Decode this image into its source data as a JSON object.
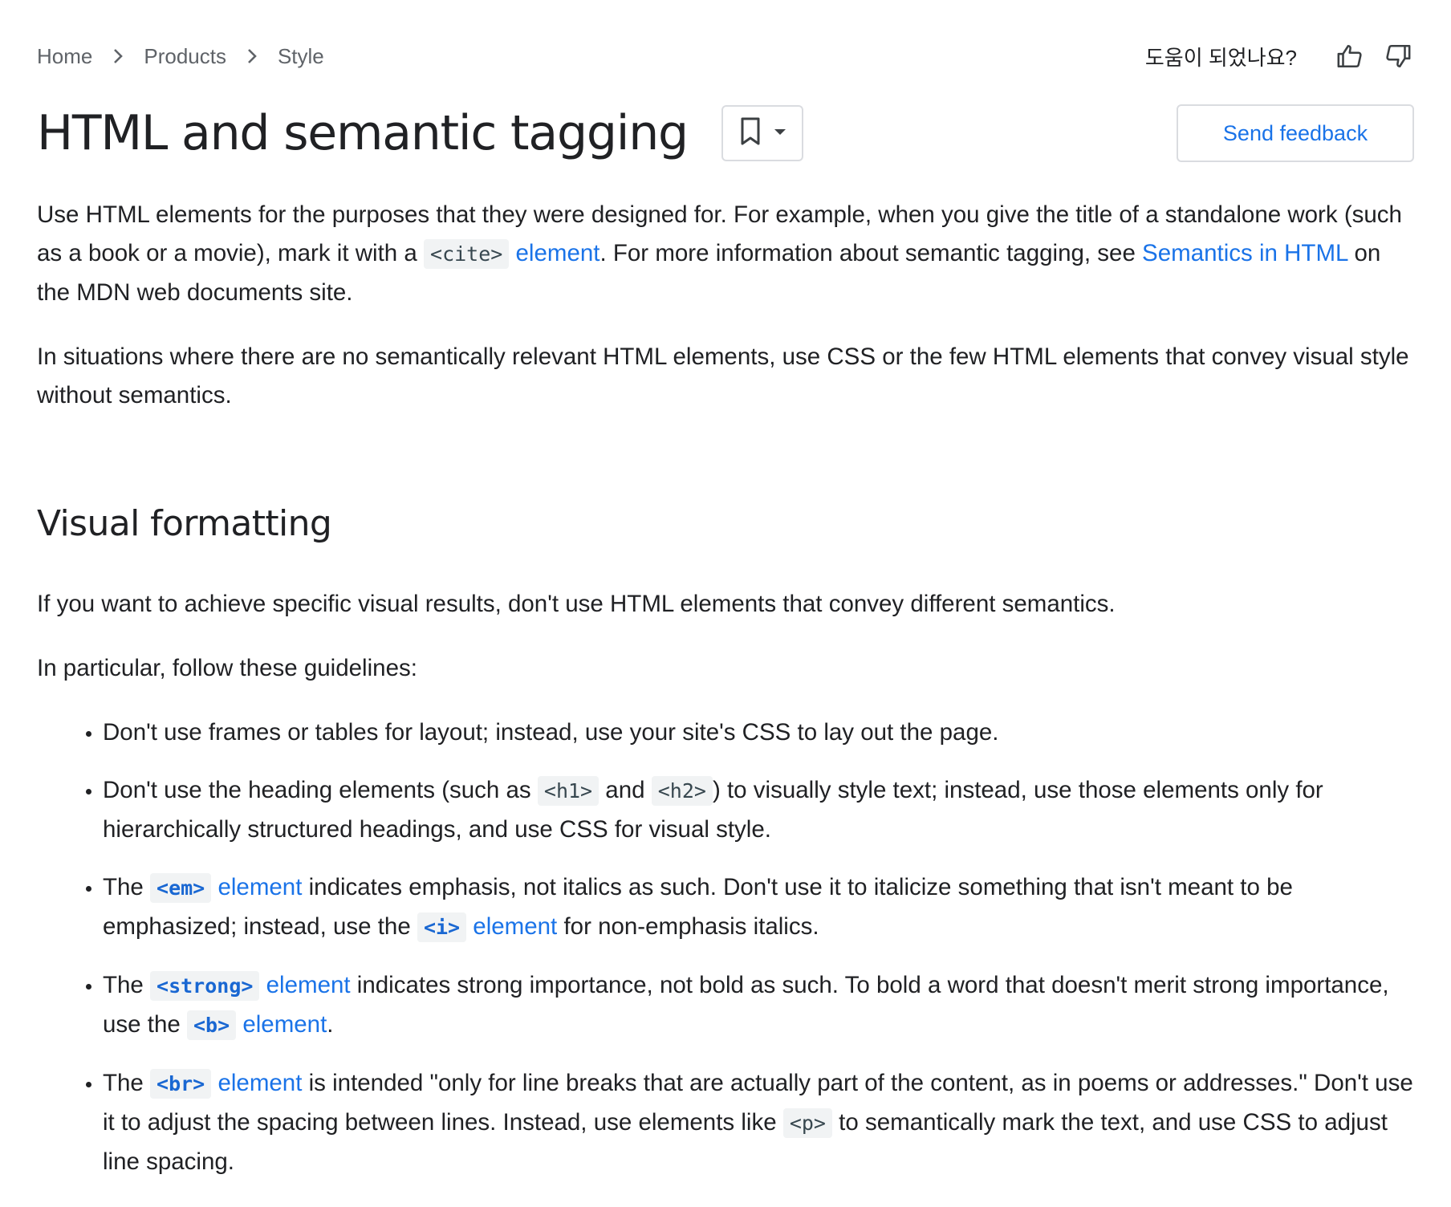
{
  "breadcrumb": {
    "items": [
      "Home",
      "Products",
      "Style"
    ]
  },
  "helpful": {
    "question": "도움이 되었나요?",
    "up_icon": "thumb-up-icon",
    "down_icon": "thumb-down-icon"
  },
  "page": {
    "title": "HTML and semantic tagging",
    "bookmark_icon": "bookmark-icon",
    "dropdown_icon": "caret-down-icon",
    "feedback_label": "Send feedback"
  },
  "intro": {
    "p1_a": "Use HTML elements for the purposes that they were designed for. For example, when you give the title of a standalone work (such as a book or a movie), mark it with a ",
    "p1_code": "<cite>",
    "p1_link": " element",
    "p1_b": ". For more information about semantic tagging, see ",
    "p1_link2": "Semantics in HTML",
    "p1_c": " on the MDN web documents site.",
    "p2": "In situations where there are no semantically relevant HTML elements, use CSS or the few HTML elements that convey visual style without semantics."
  },
  "section": {
    "heading": "Visual formatting",
    "p1": "If you want to achieve specific visual results, don't use HTML elements that convey different semantics.",
    "p2": "In particular, follow these guidelines:",
    "li1": "Don't use frames or tables for layout; instead, use your site's CSS to lay out the page.",
    "li2_a": "Don't use the heading elements (such as ",
    "li2_code1": "<h1>",
    "li2_b": " and ",
    "li2_code2": "<h2>",
    "li2_c": ") to visually style text; instead, use those elements only for hierarchically structured headings, and use CSS for visual style.",
    "li3_a": "The ",
    "li3_code1": "<em>",
    "li3_link1": " element",
    "li3_b": " indicates emphasis, not italics as such. Don't use it to italicize something that isn't meant to be emphasized; instead, use the ",
    "li3_code2": "<i>",
    "li3_link2": " element",
    "li3_c": " for non-emphasis italics.",
    "li4_a": "The ",
    "li4_code1": "<strong>",
    "li4_link1": " element",
    "li4_b": " indicates strong importance, not bold as such. To bold a word that doesn't merit strong importance, use the ",
    "li4_code2": "<b>",
    "li4_link2": " element",
    "li4_c": ".",
    "li5_a": "The ",
    "li5_code1": "<br>",
    "li5_link1": " element",
    "li5_b": " is intended \"only for line breaks that are actually part of the content, as in poems or addresses.\" Don't use it to adjust the spacing between lines. Instead, use elements like ",
    "li5_code2": "<p>",
    "li5_c": " to semantically mark the text, and use CSS to adjust line spacing."
  }
}
